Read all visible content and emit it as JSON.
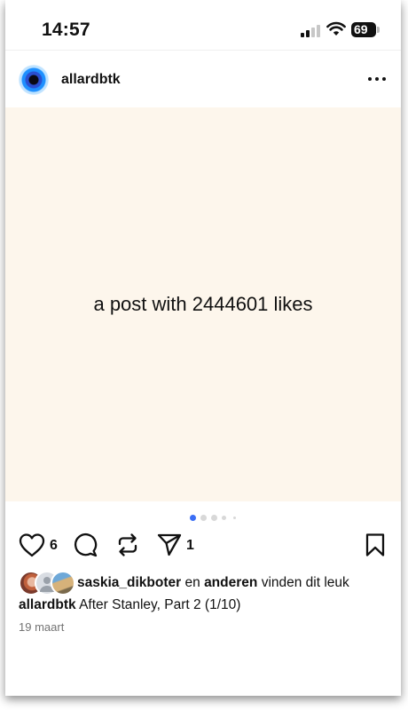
{
  "status_bar": {
    "time": "14:57",
    "battery": "69"
  },
  "post": {
    "username": "allardbtk",
    "image_text": "a post with 2444601 likes",
    "carousel": {
      "total_dots": 5,
      "active_index": 0
    },
    "like_count": "6",
    "share_count": "1",
    "likes_line": {
      "first_user": "saskia_dikboter",
      "connector": "en",
      "others": "anderen",
      "suffix": "vinden dit leuk"
    },
    "caption": {
      "username": "allardbtk",
      "text": "After Stanley, Part 2 (1/10)"
    },
    "date": "19 maart"
  },
  "icons": {
    "like": "heart-icon",
    "comment": "comment-icon",
    "repost": "repost-icon",
    "share": "send-icon",
    "save": "bookmark-icon",
    "more": "more-icon"
  },
  "colors": {
    "post_background": "#fdf6ec",
    "active_dot": "#3b6ef5",
    "inactive_dot": "#d8d8d8",
    "secondary_text": "#737373"
  }
}
